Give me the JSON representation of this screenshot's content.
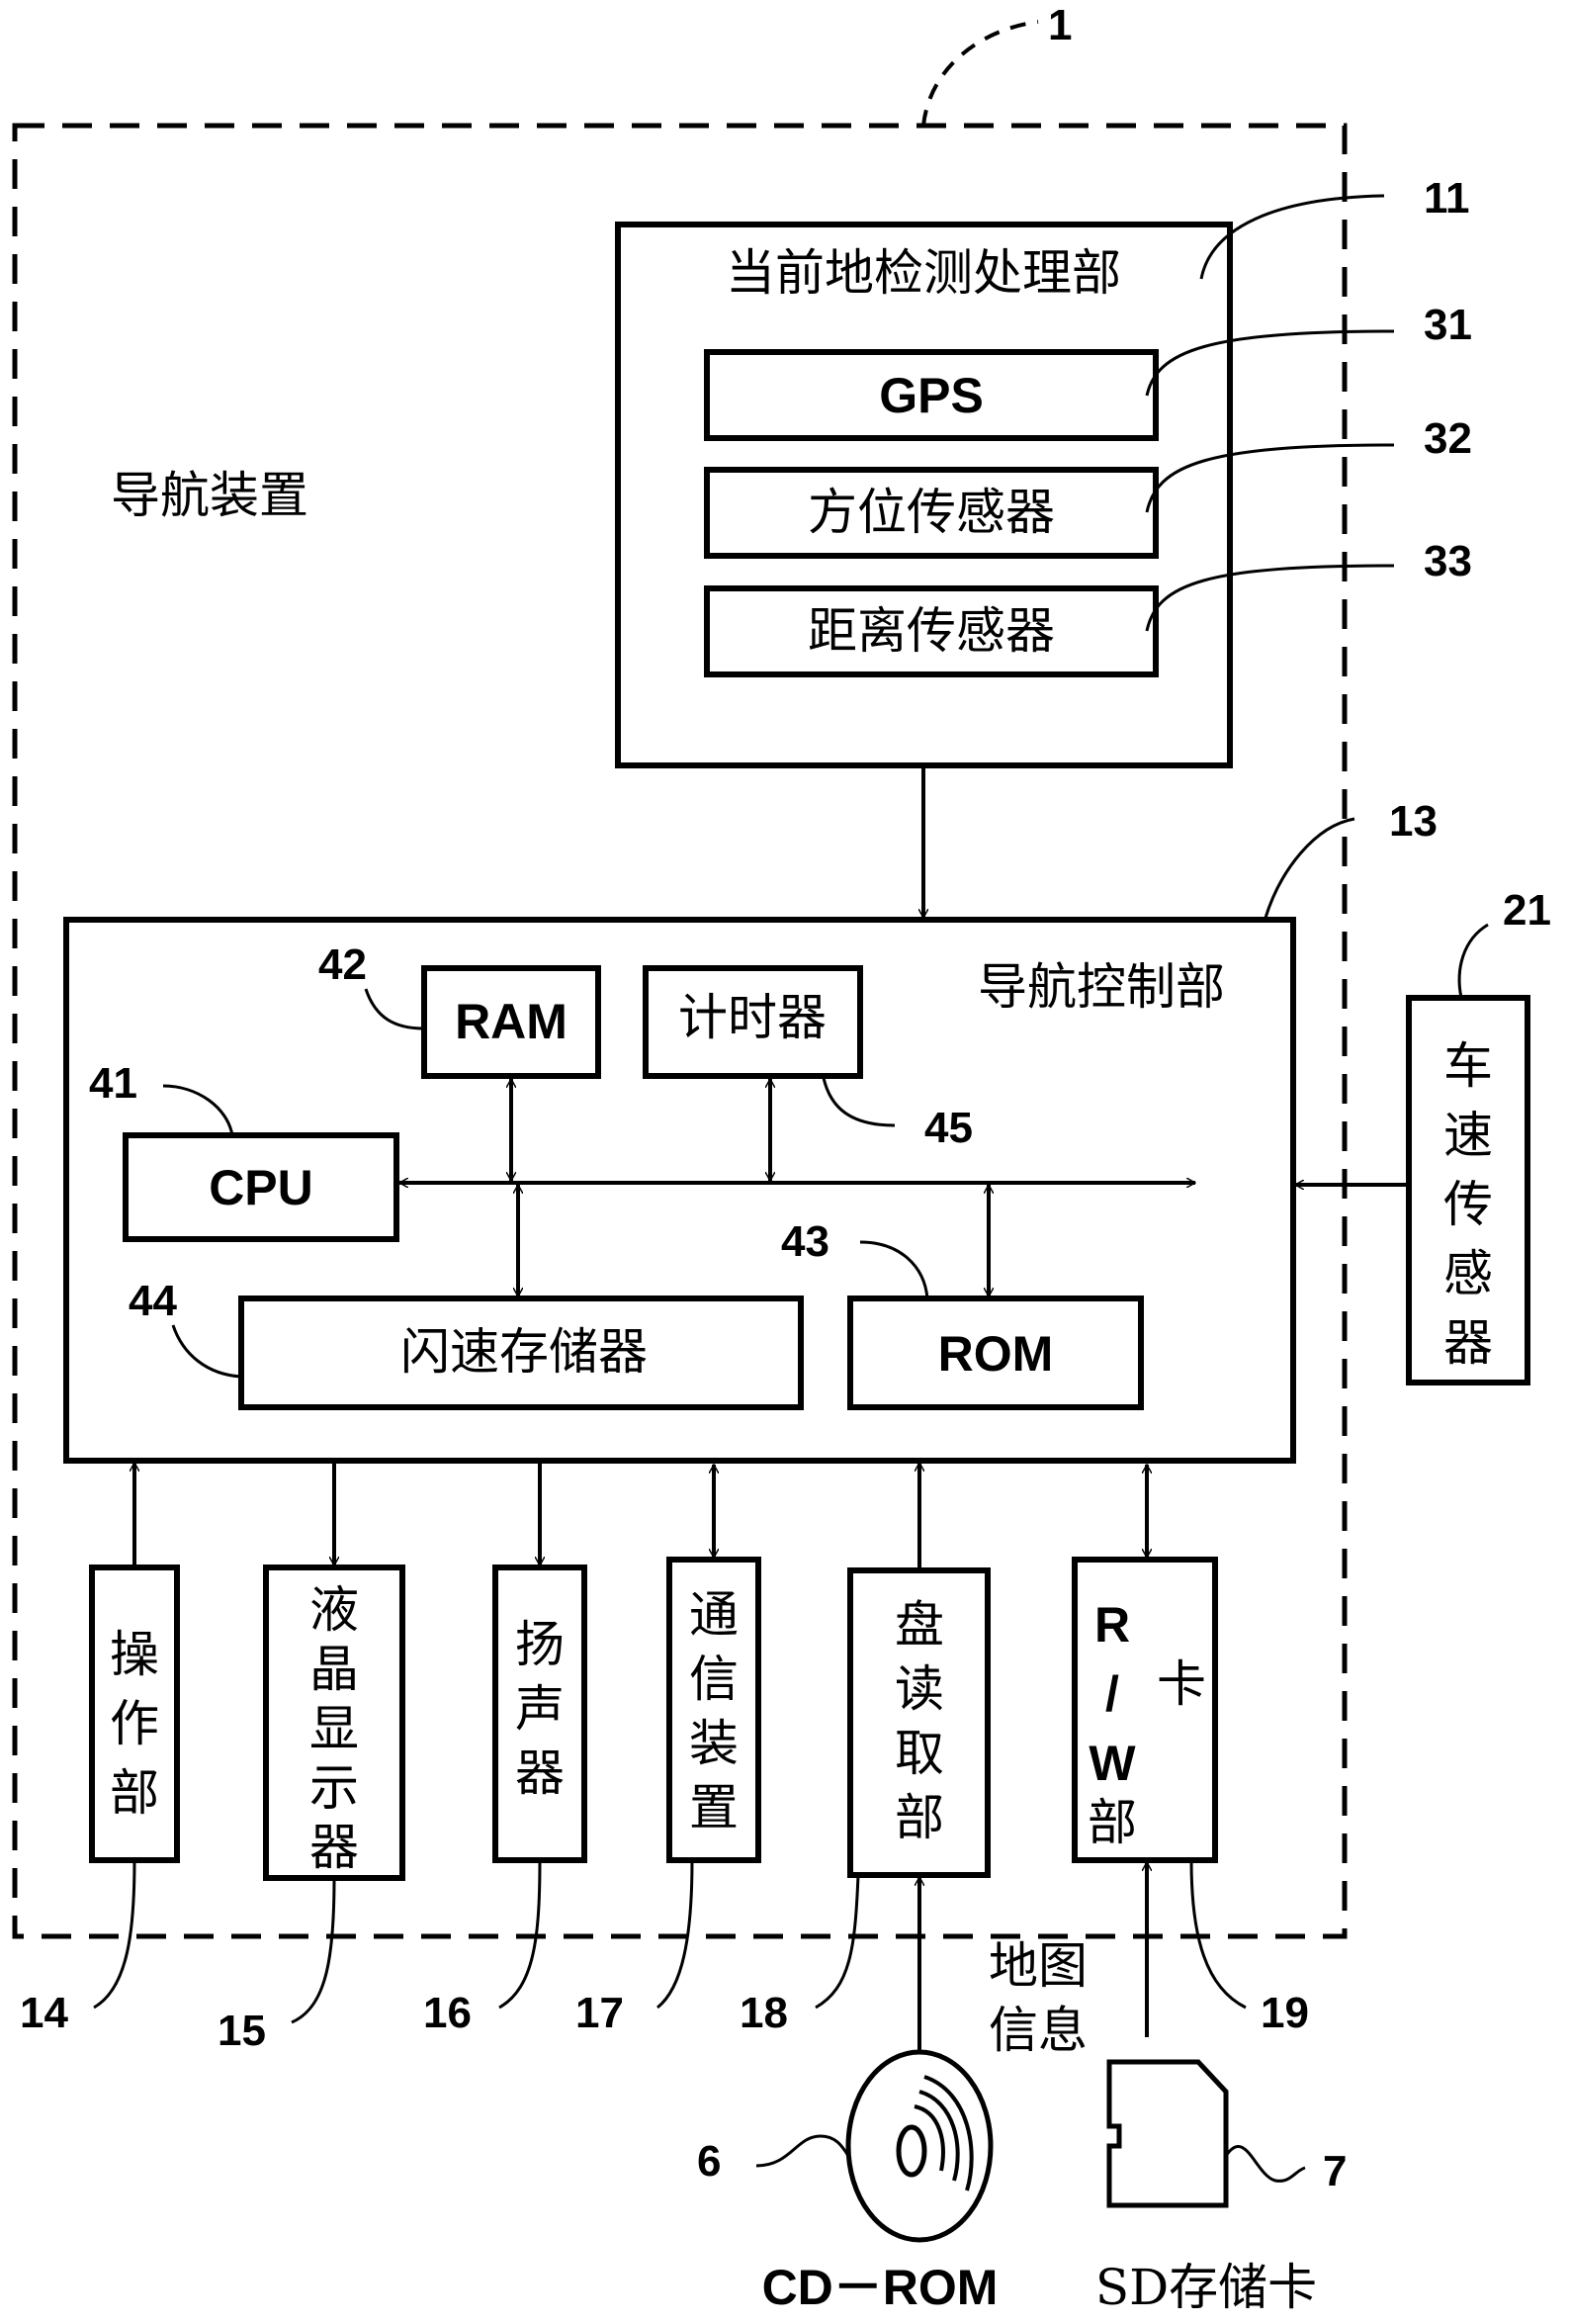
{
  "diagram": {
    "device": {
      "ref": "1",
      "label": "导航装置"
    },
    "current_position_unit": {
      "ref": "11",
      "title": "当前地检测处理部",
      "components": [
        {
          "ref": "31",
          "label": "GPS"
        },
        {
          "ref": "32",
          "label": "方位传感器"
        },
        {
          "ref": "33",
          "label": "距离传感器"
        }
      ]
    },
    "nav_control_unit": {
      "ref": "13",
      "title": "导航控制部",
      "components": [
        {
          "ref": "41",
          "label": "CPU"
        },
        {
          "ref": "42",
          "label": "RAM"
        },
        {
          "ref": "43",
          "label": "ROM"
        },
        {
          "ref": "44",
          "label": "闪速存储器"
        },
        {
          "ref": "45",
          "label": "计时器"
        }
      ]
    },
    "vehicle_speed_sensor": {
      "ref": "21",
      "label": [
        "车",
        "速",
        "传",
        "感",
        "器"
      ]
    },
    "peripherals": [
      {
        "ref": "14",
        "label": [
          "操",
          "作",
          "部"
        ]
      },
      {
        "ref": "15",
        "label": [
          "液",
          "晶",
          "显",
          "示",
          "器"
        ]
      },
      {
        "ref": "16",
        "label": [
          "扬",
          "声",
          "器"
        ]
      },
      {
        "ref": "17",
        "label": [
          "通",
          "信",
          "装",
          "置"
        ]
      },
      {
        "ref": "18",
        "label": [
          "盘",
          "读",
          "取",
          "部"
        ]
      },
      {
        "ref": "19",
        "label": {
          "rw_top": "R",
          "rw_slash": "/",
          "rw_bottom": "W",
          "card": "卡",
          "unit": "部"
        }
      }
    ],
    "map_info_label": [
      "地图",
      "信息"
    ],
    "media": [
      {
        "ref": "6",
        "label": "CD－ROM"
      },
      {
        "ref": "7",
        "label": "SD存储卡"
      }
    ]
  }
}
